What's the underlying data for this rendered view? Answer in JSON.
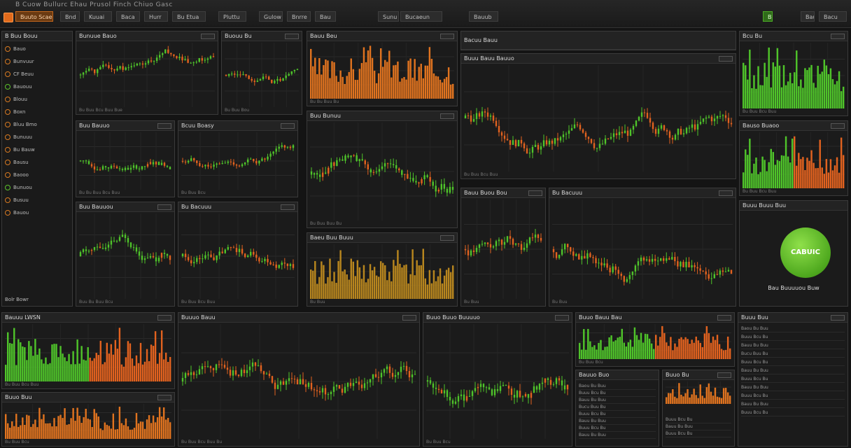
{
  "colors": {
    "up": "#4fc42a",
    "down": "#e2621f",
    "bar_orange": "#e0731f",
    "bar_gold": "#b8861e",
    "bg": "#141414",
    "panel": "#1b1b1b"
  },
  "topbar": {
    "menu": "B  Cuow  Bullurc  Ehau  Prusol  Finch  Chiuo  Gasc",
    "buttons": [
      {
        "label": "Buuto Scae",
        "style": "",
        "icon": "orange-app-icon"
      },
      {
        "label": "Bnd",
        "style": ""
      },
      {
        "label": "Kuuai",
        "style": ""
      },
      {
        "label": "Baca",
        "style": ""
      },
      {
        "label": "Hurr",
        "style": ""
      },
      {
        "label": "Bu Etua",
        "style": ""
      },
      {
        "label": "Pluttu",
        "style": ""
      },
      {
        "label": "Gulow",
        "style": ""
      },
      {
        "label": "Bnrre",
        "style": ""
      },
      {
        "label": "Bau",
        "style": ""
      },
      {
        "label": "Sunu",
        "style": ""
      },
      {
        "label": "Bucaeun",
        "style": ""
      },
      {
        "label": "Bauub",
        "style": ""
      },
      {
        "label": "Bu",
        "style": "green"
      },
      {
        "label": "Bauic",
        "style": ""
      },
      {
        "label": "Bacu",
        "style": ""
      }
    ]
  },
  "sidebar": {
    "title": "B Buu Bouu",
    "items": [
      "Bauo",
      "Bunvuur",
      "CF Beuu",
      "Bauouu",
      "Blouu",
      "Boxn",
      "Bluu Bmo",
      "Bunuuu",
      "Bu Bauw",
      "Bausu",
      "Baooo",
      "Bunuou",
      "Busuu",
      "Bauou"
    ],
    "footer": "Bolr Bowr"
  },
  "panels": {
    "p1": {
      "title": "Bunuue Bauo",
      "foot": "Bu  Buu  Bcu  Buu  Bue"
    },
    "p2": {
      "title": "Buouu Bu",
      "foot": "Bu  Buu  Bou"
    },
    "p3": {
      "title": "Bauu Beu",
      "foot": "Bu  Bu  Buu  Bu"
    },
    "p4": {
      "title": "Bacuu Bauu",
      "foot": "Bu  Buu  Bcu"
    },
    "p5": {
      "title": "Bcu Bu",
      "foot": "Bu  Buu  Bcu  Buu"
    },
    "p6": {
      "title": "Buuu Bauu Bauuo",
      "foot": "Bu  Buu  Bcu  Buu"
    },
    "p7": {
      "title": "Buu Bauuo",
      "foot": "Bu  Bu  Buu  Bcu  Buu"
    },
    "p8": {
      "title": "Bcuu Boasy",
      "foot": "Bu  Buu  Bcu"
    },
    "p9": {
      "title": "Buu Bunuu",
      "foot": "Bu  Buu  Buu  Bu"
    },
    "p10": {
      "title": "Bauso Buaoo",
      "foot": "Bu  Buu  Bcu  Buu"
    },
    "p11": {
      "title": "Buu Bauuou",
      "foot": "Buu  Bu  Buu  Bcu"
    },
    "p12": {
      "title": "Bu Bacuuu",
      "foot": "Bu  Buu  Bcu  Buu"
    },
    "p13": {
      "title": "Baeu Buu Buuu",
      "foot": "Bu  Buu"
    },
    "p14": {
      "title": "Bauu Buou Bou",
      "foot": "Bu  Buu"
    },
    "p15": {
      "title": "Buuu Buuu Buu",
      "badge": "CABUIC",
      "foot": "Bau Buuuuou Buw"
    },
    "p16": {
      "title": "Bauuu LWSN",
      "foot": "Bu  Buu  Bcu  Buu"
    },
    "p17": {
      "title": "Buuo Buu",
      "foot": "Bu  Buu  Bcu"
    },
    "p18": {
      "title": "Buuuo Bauu",
      "foot": "Bu  Buu  Bcu  Buu  Bu"
    },
    "p19": {
      "title": "Buuo Buuo Buuuuo",
      "foot": "Bu  Buu  Bcu"
    },
    "p20": {
      "title": "Buuo Bauu Bau",
      "foot": "Bu  Buu  Bcu"
    },
    "p21": {
      "title": "Bauuo Buo",
      "foot": "Bu  Buu"
    },
    "p22": {
      "title": "Buuo Bu",
      "foot": "Bu  Buu"
    },
    "p23": {
      "title": "Buuu Buu",
      "foot": "Bu  Buu"
    }
  },
  "table_rows": [
    "Baou  Bu  Buu",
    "Buuu  Bcu  Bu",
    "Bauu  Bu  Buu",
    "Bucu  Buu  Bu",
    "Buuu  Bcu  Bu",
    "Bauu  Bu  Buu",
    "Buuu  Bcu  Bu",
    "Bauu  Bu  Buu",
    "Buuu  Bcu  Bu",
    "Bauu  Bu  Buu",
    "Buuu  Bcu  Bu"
  ],
  "axis_labels": [
    "Bu",
    "Buu",
    "Bcu",
    "Buu",
    "Bu",
    "Buu",
    "Bcu",
    "Buu"
  ]
}
